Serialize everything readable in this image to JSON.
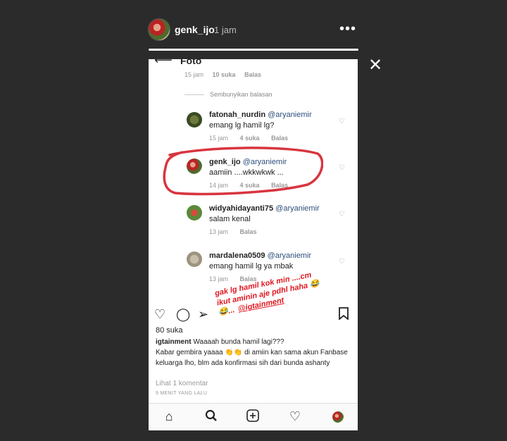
{
  "story": {
    "username": "genk_ijo",
    "time": "1 jam",
    "more_icon": "more-horizontal-icon",
    "close_icon": "close-icon"
  },
  "screen": {
    "title": "Foto",
    "top_meta": {
      "time": "15 jam",
      "likes": "10 suka",
      "reply": "Balas"
    },
    "hide_replies": "Sembunyikan balasan",
    "comments": [
      {
        "username": "fatonah_nurdin",
        "mention": "@aryaniemir",
        "text": "emang lg hamil lg?",
        "time": "15 jam",
        "likes": "4 suka",
        "reply": "Balas"
      },
      {
        "username": "genk_ijo",
        "mention": "@aryaniemir",
        "text": "aamiin ....wkkwkwk ...",
        "time": "14 jam",
        "likes": "4 suka",
        "reply": "Balas"
      },
      {
        "username": "widyahidayanti75",
        "mention": "@aryaniemir",
        "text": "salam kenal",
        "time": "13 jam",
        "reply": "Balas"
      },
      {
        "username": "mardalena0509",
        "mention": "@aryaniemir",
        "text": "emang hamil lg ya mbak",
        "time": "13 jam",
        "reply": "Balas"
      }
    ],
    "likes_count": "80 suka",
    "caption": {
      "username": "igtainment",
      "line1": "Waaaah bunda hamil lagi???",
      "line2": "Kabar gembira yaaaa 👏👏 di amiin kan sama akun Fanbase keluarga lho, blm ada konfirmasi sih dari bunda ashanty"
    },
    "view_comments": "Lihat 1 komentar",
    "time_ago": "9 MENIT YANG LALU"
  },
  "overlay": {
    "line1": "gak lg hamil kok min ....cm",
    "line2": "ikut aminin aje pdhl haha 😂",
    "line3": "😂... ",
    "tag": "@igtainment"
  },
  "colors": {
    "highlight": "#e0171f",
    "mention": "#2d4f7c"
  }
}
